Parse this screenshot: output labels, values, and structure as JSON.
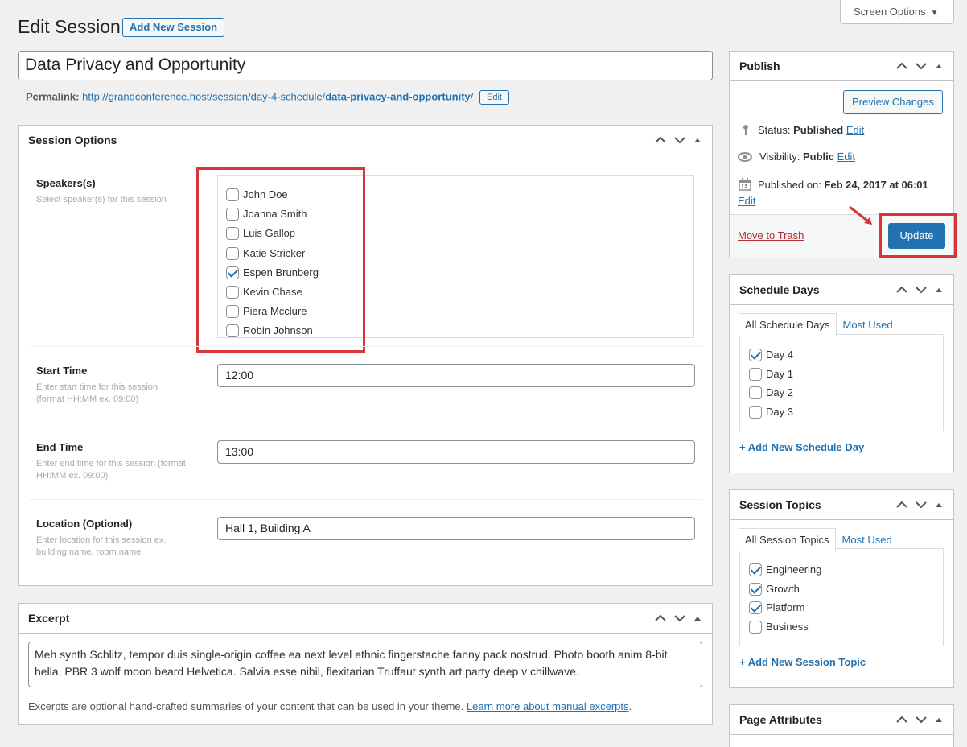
{
  "header": {
    "title": "Edit Session",
    "add_new": "Add New Session",
    "screen_options": "Screen Options"
  },
  "post": {
    "title_value": "Data Privacy and Opportunity",
    "permalink_label": "Permalink:",
    "permalink_base": "http://grandconference.host/session/day-4-schedule/",
    "permalink_slug": "data-privacy-and-opportunity",
    "permalink_trail": "/",
    "permalink_edit": "Edit"
  },
  "session_options": {
    "title": "Session Options",
    "speakers_label": "Speakers(s)",
    "speakers_desc": "Select speaker(s) for this session",
    "speakers": [
      {
        "name": "John Doe",
        "checked": false
      },
      {
        "name": "Joanna Smith",
        "checked": false
      },
      {
        "name": "Luis Gallop",
        "checked": false
      },
      {
        "name": "Katie Stricker",
        "checked": false
      },
      {
        "name": "Espen Brunberg",
        "checked": true
      },
      {
        "name": "Kevin Chase",
        "checked": false
      },
      {
        "name": "Piera Mcclure",
        "checked": false
      },
      {
        "name": "Robin Johnson",
        "checked": false
      }
    ],
    "start_label": "Start Time",
    "start_desc_1": "Enter start time for this session",
    "start_desc_2": "(format HH:MM ex. 09:00)",
    "start_value": "12:00",
    "end_label": "End Time",
    "end_desc_1": "Enter end time for this session (format",
    "end_desc_2": "HH:MM ex. 09:00)",
    "end_value": "13:00",
    "location_label": "Location (Optional)",
    "location_desc_1": "Enter location for this session ex.",
    "location_desc_2": "building name, room name",
    "location_value": "Hall 1, Building A"
  },
  "excerpt": {
    "title": "Excerpt",
    "text": "Meh synth Schlitz, tempor duis single-origin coffee ea next level ethnic fingerstache fanny pack nostrud. Photo booth anim 8-bit hella, PBR 3 wolf moon beard Helvetica. Salvia esse nihil, flexitarian Truffaut synth art party deep v chillwave.",
    "help": "Excerpts are optional hand-crafted summaries of your content that can be used in your theme.",
    "help_link": "Learn more about manual excerpts",
    "help_end": "."
  },
  "publish": {
    "title": "Publish",
    "preview": "Preview Changes",
    "status_label": "Status:",
    "status_value": "Published",
    "visibility_label": "Visibility:",
    "visibility_value": "Public",
    "published_label": "Published on:",
    "published_value": "Feb 24, 2017 at 06:01",
    "edit": "Edit",
    "trash": "Move to Trash",
    "update": "Update"
  },
  "schedule_days": {
    "title": "Schedule Days",
    "tab_all": "All Schedule Days",
    "tab_most": "Most Used",
    "items": [
      {
        "name": "Day 4",
        "checked": true
      },
      {
        "name": "Day 1",
        "checked": false
      },
      {
        "name": "Day 2",
        "checked": false
      },
      {
        "name": "Day 3",
        "checked": false
      }
    ],
    "add_new": "+ Add New Schedule Day"
  },
  "session_topics": {
    "title": "Session Topics",
    "tab_all": "All Session Topics",
    "tab_most": "Most Used",
    "items": [
      {
        "name": "Engineering",
        "checked": true
      },
      {
        "name": "Growth",
        "checked": true
      },
      {
        "name": "Platform",
        "checked": true
      },
      {
        "name": "Business",
        "checked": false
      }
    ],
    "add_new": "+ Add New Session Topic"
  },
  "page_attributes": {
    "title": "Page Attributes"
  },
  "colors": {
    "accent": "#2271b1",
    "highlight": "#d63638",
    "trash": "#b32d2e"
  }
}
